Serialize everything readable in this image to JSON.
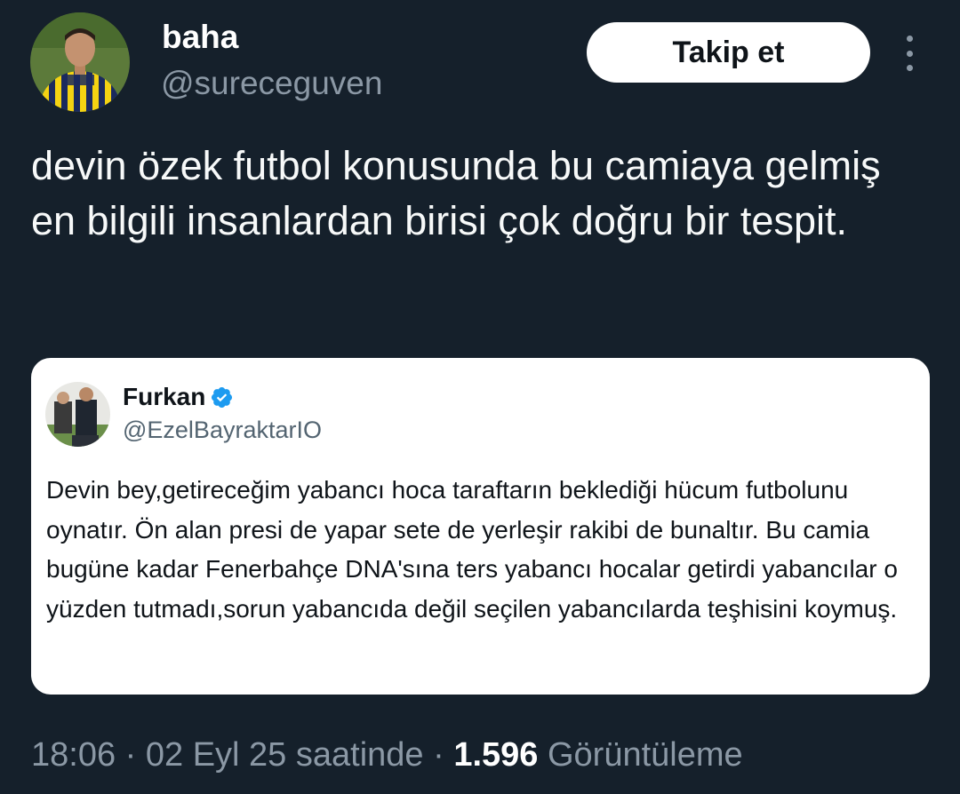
{
  "author": {
    "display_name": "baha",
    "handle": "@sureceguven",
    "avatar_icon": "profile-photo-icon"
  },
  "follow_button": {
    "label": "Takip et"
  },
  "more_menu": {
    "icon": "more-vertical-icon"
  },
  "tweet": {
    "text": "devin özek futbol konusunda bu camiaya gelmiş en bilgili insanlardan birisi çok doğru bir tespit."
  },
  "quoted_tweet": {
    "display_name": "Furkan",
    "verified": true,
    "verified_icon": "verified-badge-icon",
    "handle": "@EzelBayraktarIO",
    "text": "Devin bey,getireceğim yabancı hoca taraftarın beklediği hücum futbolunu oynatır. Ön alan presi de yapar sete de yerleşir rakibi de bunaltır. Bu camia bugüne kadar Fenerbahçe DNA'sına ters yabancı hocalar getirdi yabancılar o yüzden tutmadı,sorun yabancıda değil seçilen yabancılarda teşhisini koymuş."
  },
  "meta": {
    "time": "18:06",
    "separator": " · ",
    "date": "02 Eyl 25 saatinde",
    "views_count": "1.596",
    "views_label": "Görüntüleme"
  },
  "colors": {
    "background": "#15202b",
    "text_primary": "#ffffff",
    "text_secondary": "#8b98a5",
    "card_background": "#ffffff",
    "card_text": "#0f1419",
    "verified_blue": "#1d9bf0"
  }
}
